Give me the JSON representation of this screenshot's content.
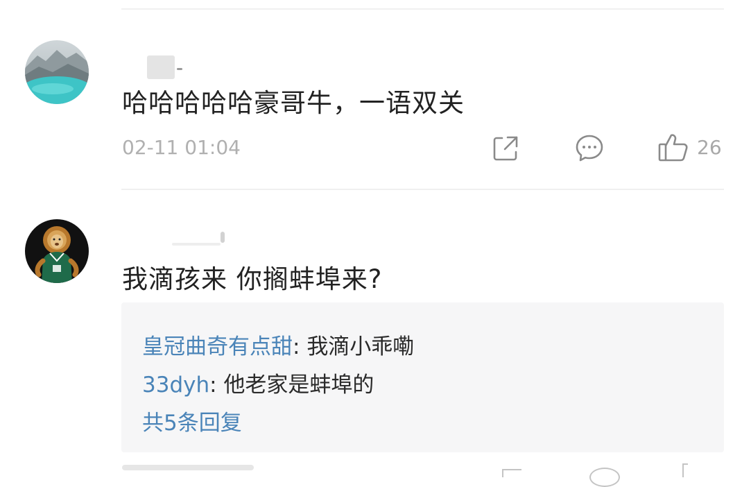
{
  "comments": [
    {
      "text": "哈哈哈哈哈豪哥牛，一语双关",
      "time": "02-11 01:04",
      "like_count": "26",
      "icons": [
        "share-icon",
        "comment-icon",
        "thumbs-up-icon"
      ]
    },
    {
      "text": "我滴孩来 你搁蚌埠来?",
      "replies": [
        {
          "author": "皇冠曲奇有点甜",
          "separator": ": ",
          "text": "我滴小乖嘞"
        },
        {
          "author": "33dyh",
          "separator": ": ",
          "text": "他老家是蚌埠的"
        }
      ],
      "more_replies": "共5条回复"
    }
  ],
  "colors": {
    "link": "#4a84b8",
    "text": "#222222",
    "meta": "#b0b0b0",
    "reply_bg": "#f6f6f7"
  }
}
